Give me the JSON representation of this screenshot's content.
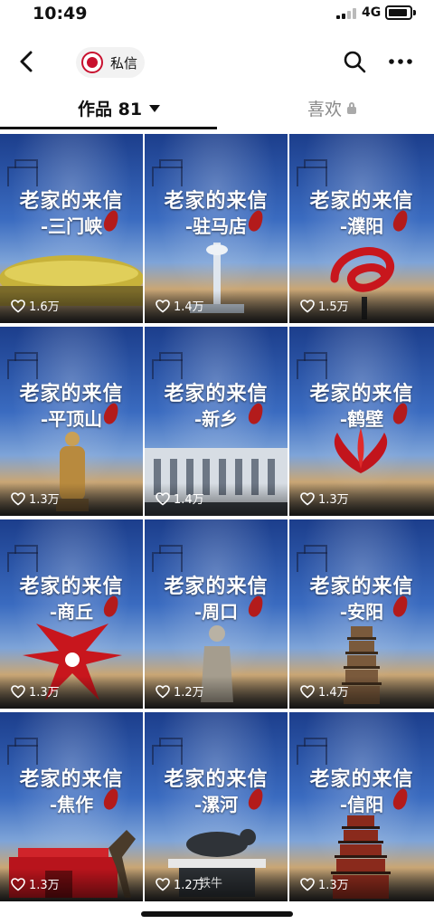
{
  "status_bar": {
    "time": "10:49",
    "network": "4G"
  },
  "nav": {
    "message_label": "私信"
  },
  "tabs": {
    "works_label": "作品 81",
    "likes_label": "喜欢"
  },
  "videos": [
    {
      "title": "老家的来信",
      "place": "-三门峡",
      "likes": "1.6万",
      "object": "stadium"
    },
    {
      "title": "老家的来信",
      "place": "-驻马店",
      "likes": "1.4万",
      "object": "tower"
    },
    {
      "title": "老家的来信",
      "place": "-濮阳",
      "likes": "1.5万",
      "object": "red-ribbon"
    },
    {
      "title": "老家的来信",
      "place": "-平顶山",
      "likes": "1.3万",
      "object": "buddha"
    },
    {
      "title": "老家的来信",
      "place": "-新乡",
      "likes": "1.4万",
      "object": "building"
    },
    {
      "title": "老家的来信",
      "place": "-鹤壁",
      "likes": "1.3万",
      "object": "red-flame"
    },
    {
      "title": "老家的来信",
      "place": "-商丘",
      "likes": "1.3万",
      "object": "red-sculpture"
    },
    {
      "title": "老家的来信",
      "place": "-周口",
      "likes": "1.2万",
      "object": "statue"
    },
    {
      "title": "老家的来信",
      "place": "-安阳",
      "likes": "1.4万",
      "object": "pagoda"
    },
    {
      "title": "老家的来信",
      "place": "-焦作",
      "likes": "1.3万",
      "object": "gate"
    },
    {
      "title": "老家的来信",
      "place": "-漯河",
      "likes": "1.2万",
      "object": "iron-ox",
      "sign": "铁牛"
    },
    {
      "title": "老家的来信",
      "place": "-信阳",
      "likes": "1.3万",
      "object": "pagoda-red"
    }
  ]
}
